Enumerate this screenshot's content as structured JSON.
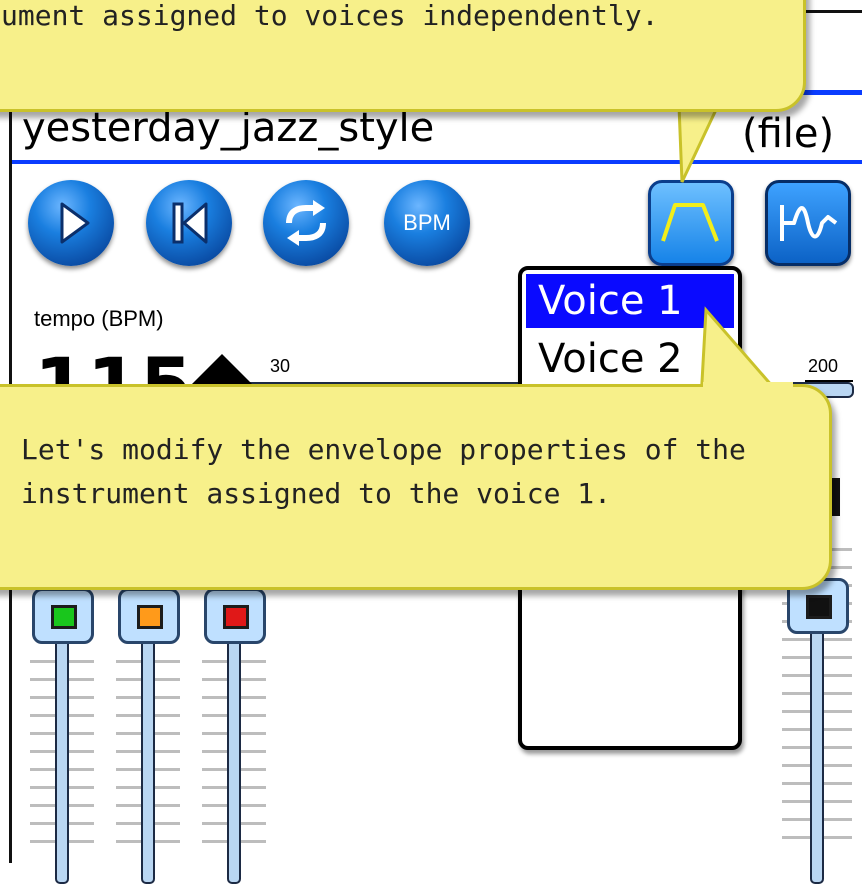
{
  "tooltip_top": {
    "text": "ument assigned to voices independently."
  },
  "song": {
    "title": "yesterday_jazz_style",
    "source": "(file)"
  },
  "transport": {
    "bpm_label": "BPM"
  },
  "tempo": {
    "label": "tempo (BPM)",
    "value": "115",
    "min_label": "30",
    "max_label": "200"
  },
  "voice_list": {
    "items": [
      "Voice 1",
      "Voice 2"
    ],
    "selected": "Voice 1"
  },
  "tooltip_main": {
    "line1": "Let's modify the envelope properties of the",
    "line2": "instrument assigned to the voice 1."
  },
  "colors": {
    "accent_blue": "#0a3cff",
    "tooltip_bg": "#f7f08a",
    "led_green": "#19c61c",
    "led_orange": "#ff9a1a",
    "led_red": "#e01818",
    "led_black": "#111111"
  }
}
